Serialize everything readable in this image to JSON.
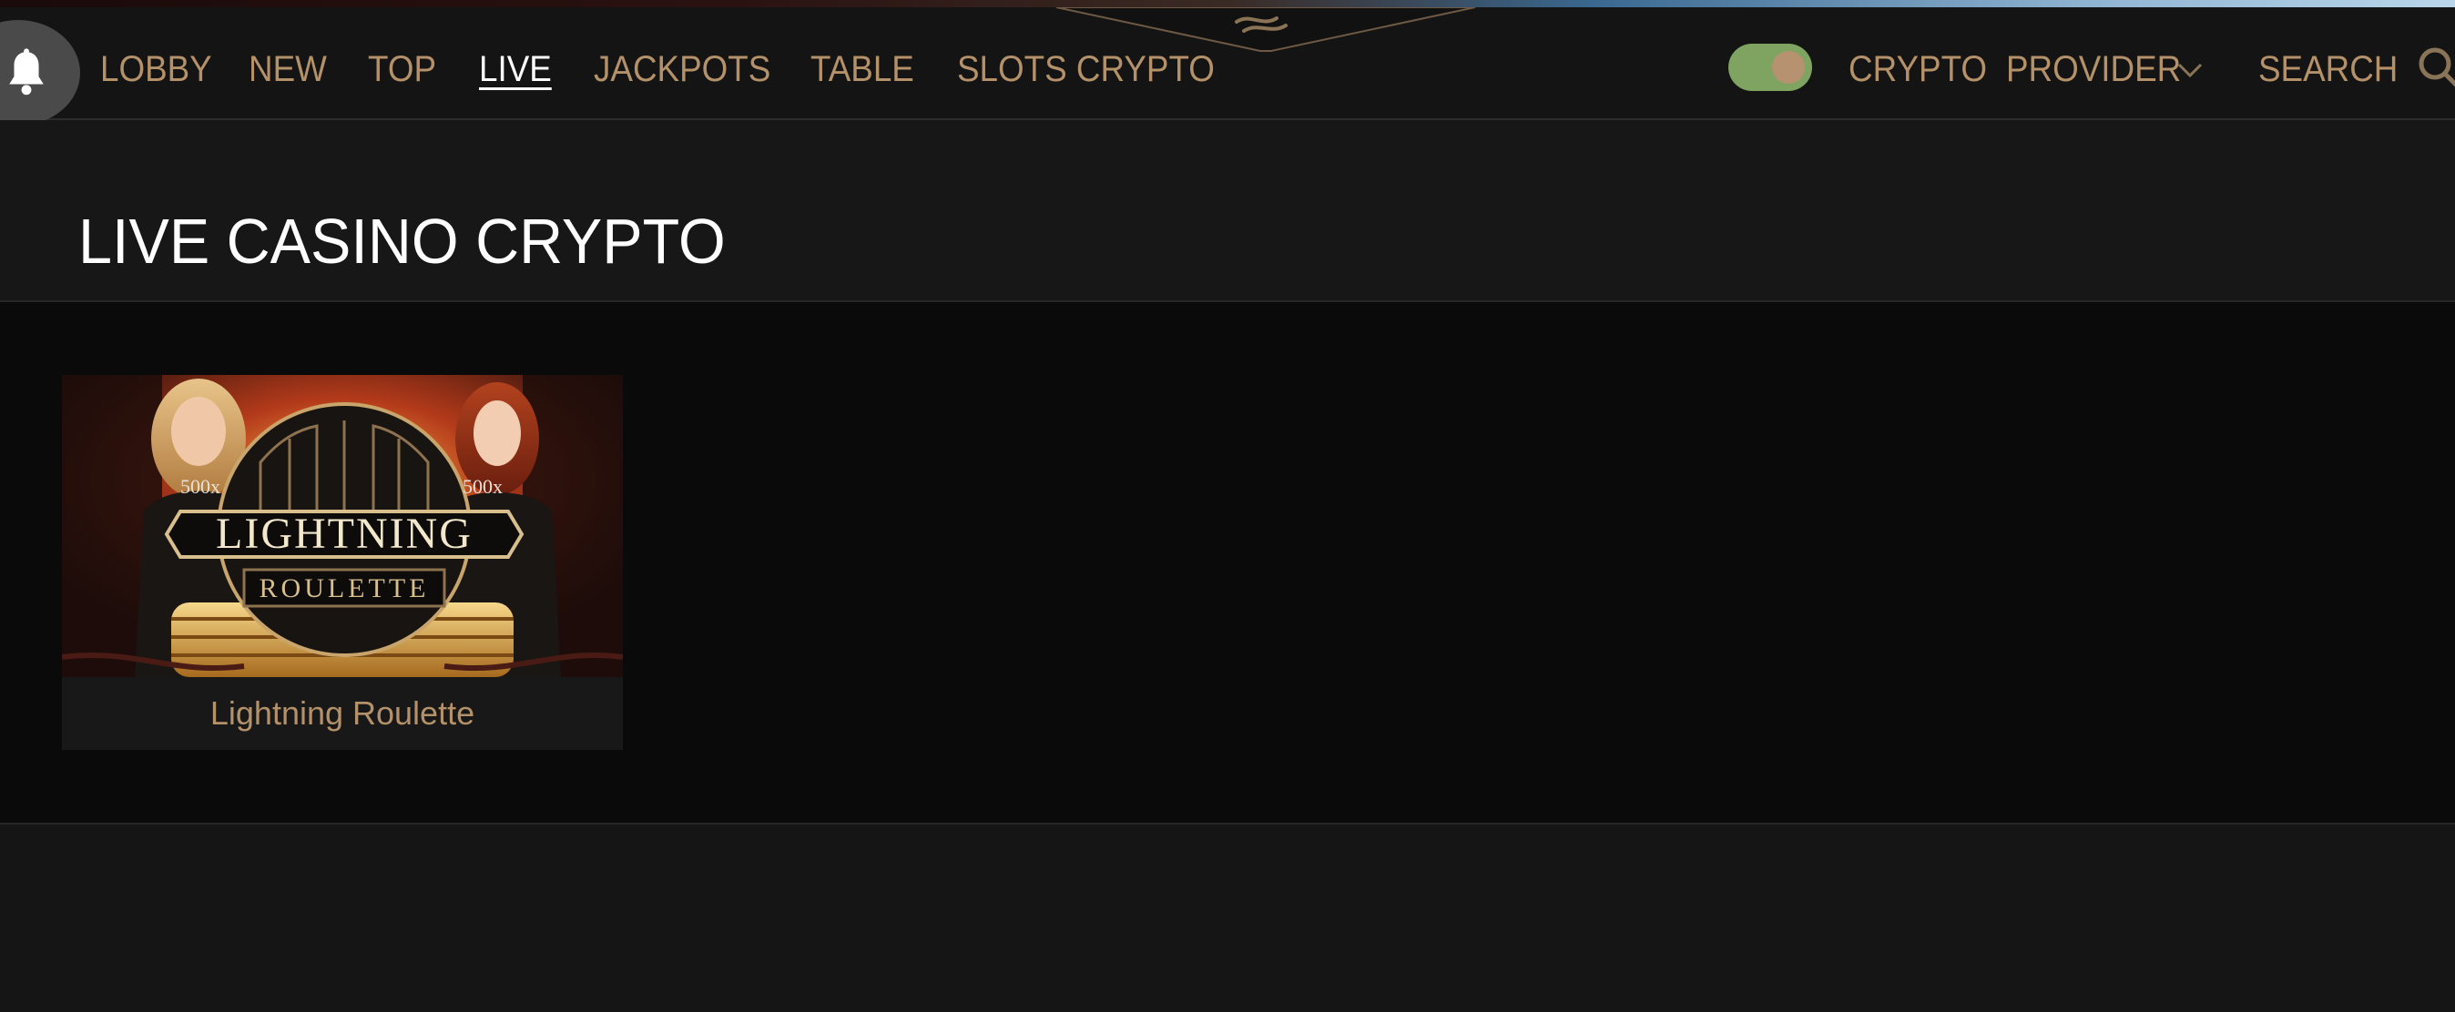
{
  "nav": {
    "items": [
      {
        "label": "LOBBY"
      },
      {
        "label": "NEW"
      },
      {
        "label": "TOP"
      },
      {
        "label": "LIVE",
        "active": true
      },
      {
        "label": "JACKPOTS"
      },
      {
        "label": "TABLE"
      },
      {
        "label": "SLOTS CRYPTO"
      }
    ],
    "crypto_label": "CRYPTO",
    "provider_label": "PROVIDER",
    "search_label": "SEARCH",
    "crypto_toggle_on": true
  },
  "page": {
    "title": "LIVE CASINO CRYPTO"
  },
  "games": [
    {
      "name": "Lightning Roulette",
      "thumb_logo_line1": "LIGHTNING",
      "thumb_logo_line2": "ROULETTE",
      "thumb_mult_left": "500x",
      "thumb_mult_right": "500x"
    }
  ],
  "colors": {
    "accent_gold": "#b49168",
    "toggle_on": "#7fa462",
    "background": "#151515"
  },
  "icons": {
    "bell": "bell-icon",
    "chevron": "chevron-down-icon",
    "search": "search-icon"
  }
}
